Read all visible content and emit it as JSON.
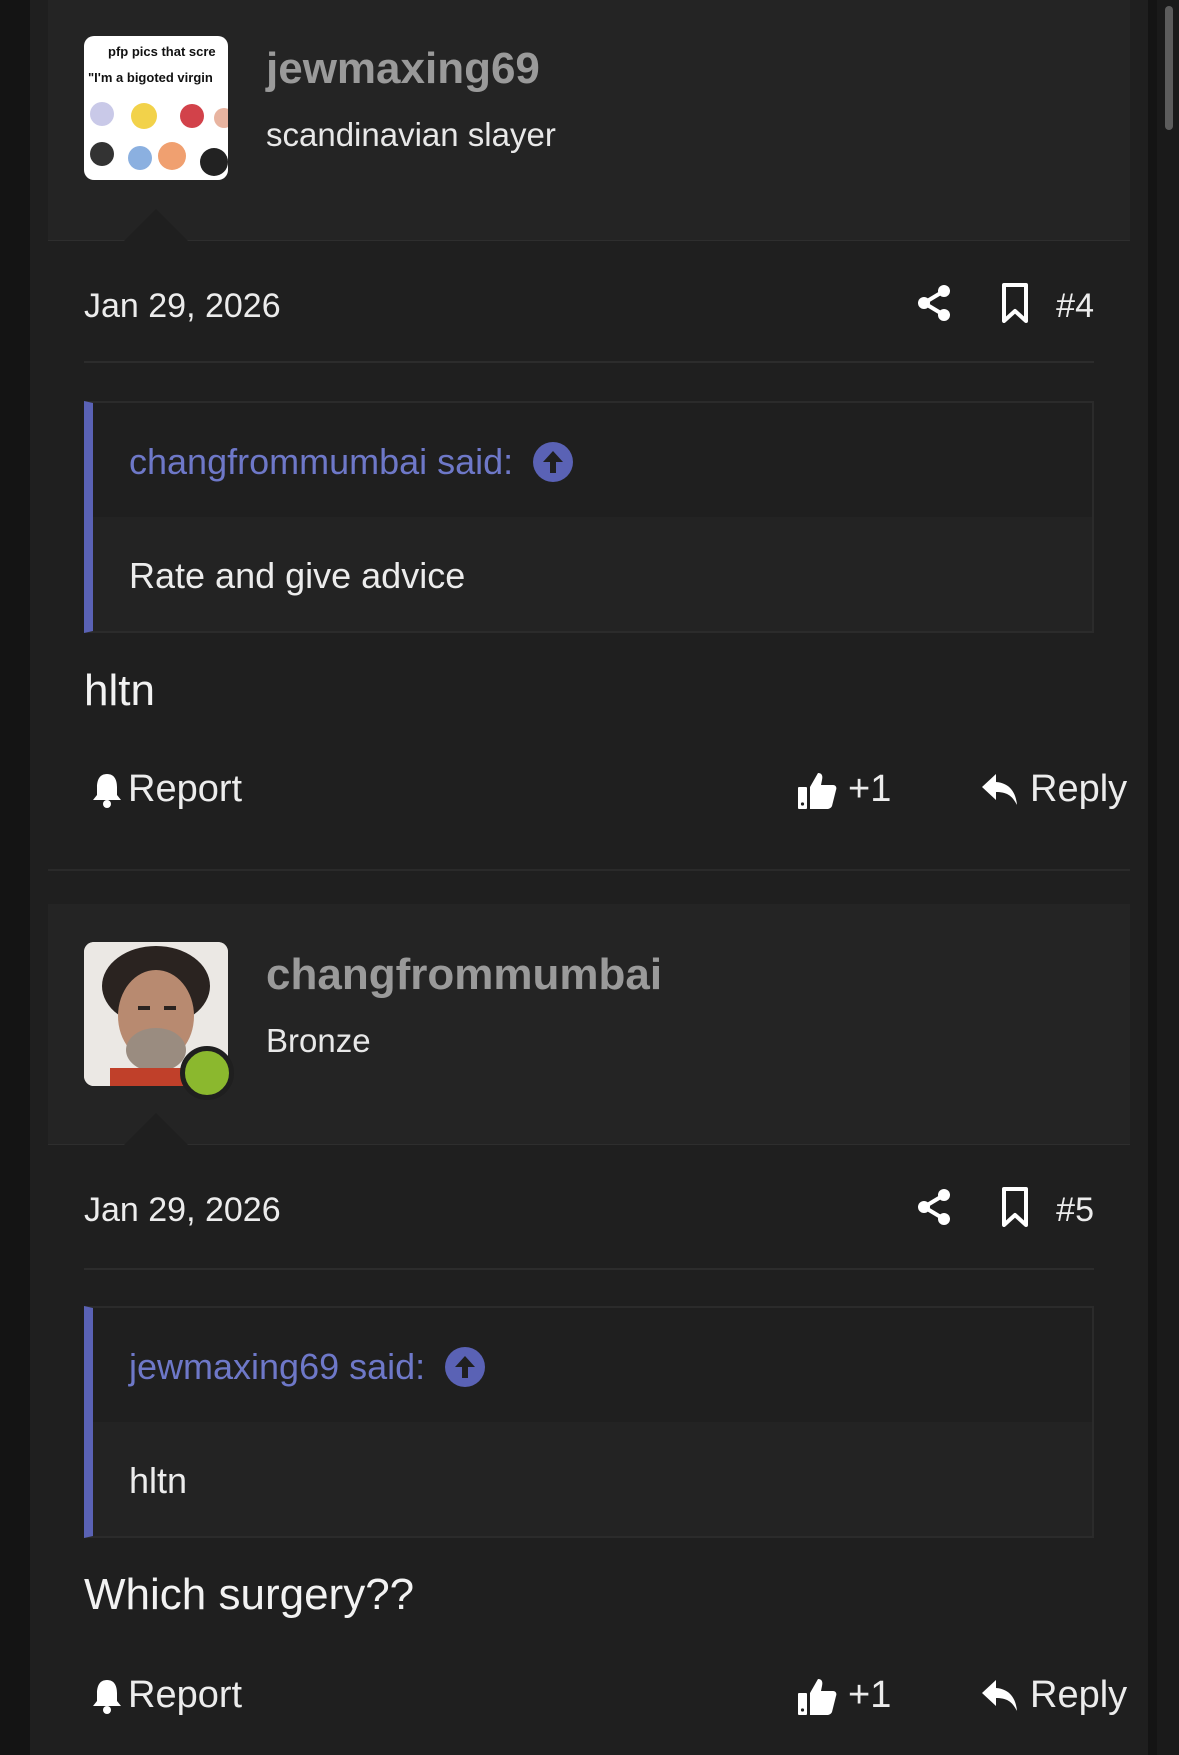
{
  "posts": [
    {
      "username": "jewmaxing69",
      "user_title": "scandinavian slayer",
      "avatar_text_line1": "pfp pics that scre",
      "avatar_text_line2": "\"I'm a bigoted virgin",
      "date": "Jan 29, 2026",
      "post_number": "#4",
      "quote_author": "changfrommumbai said:",
      "quote_text": "Rate and give advice",
      "body": "hltn",
      "report_label": "Report",
      "reaction_count": "+1",
      "reply_label": "Reply",
      "online": false
    },
    {
      "username": "changfrommumbai",
      "user_title": "Bronze",
      "date": "Jan 29, 2026",
      "post_number": "#5",
      "quote_author": "jewmaxing69 said:",
      "quote_text": "hltn",
      "body": "Which surgery??",
      "report_label": "Report",
      "reaction_count": "+1",
      "reply_label": "Reply",
      "online": true
    }
  ],
  "icons": {
    "share": "share-icon",
    "bookmark": "bookmark-icon",
    "bell": "bell-icon",
    "like": "thumbs-up-icon",
    "reply": "reply-arrow-icon",
    "quote_jump": "arrow-up-circle-icon"
  },
  "colors": {
    "accent": "#5a62b5",
    "quote_link": "#6e78c8",
    "online": "#8bb82e",
    "background": "#1f1f1f"
  }
}
